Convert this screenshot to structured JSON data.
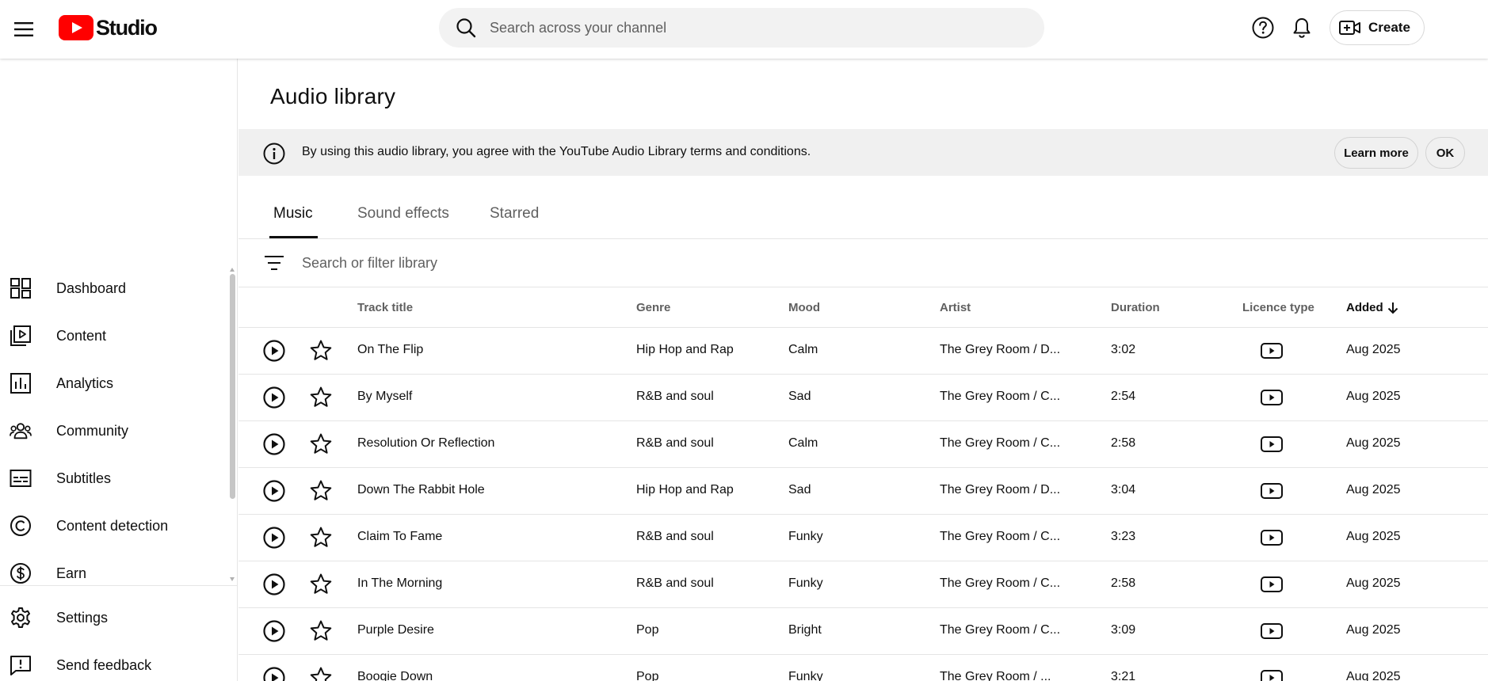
{
  "header": {
    "logo_text": "Studio",
    "search_placeholder": "Search across your channel",
    "create_label": "Create",
    "brand_color": "#ff0000"
  },
  "sidebar": {
    "items": [
      {
        "label": "Dashboard",
        "icon": "dashboard-icon"
      },
      {
        "label": "Content",
        "icon": "content-icon"
      },
      {
        "label": "Analytics",
        "icon": "analytics-icon"
      },
      {
        "label": "Community",
        "icon": "community-icon"
      },
      {
        "label": "Subtitles",
        "icon": "subtitles-icon"
      },
      {
        "label": "Content detection",
        "icon": "content-detection-icon"
      },
      {
        "label": "Earn",
        "icon": "earn-icon"
      }
    ],
    "bottom_items": [
      {
        "label": "Settings",
        "icon": "gear-icon"
      },
      {
        "label": "Send feedback",
        "icon": "feedback-icon"
      }
    ]
  },
  "main": {
    "title": "Audio library",
    "banner": {
      "text": "By using this audio library, you agree with the YouTube Audio Library terms and conditions.",
      "learn_more": "Learn more",
      "ok": "OK"
    },
    "tabs": [
      {
        "label": "Music",
        "active": true
      },
      {
        "label": "Sound effects",
        "active": false
      },
      {
        "label": "Starred",
        "active": false
      }
    ],
    "filter_placeholder": "Search or filter library",
    "columns": {
      "track": "Track title",
      "genre": "Genre",
      "mood": "Mood",
      "artist": "Artist",
      "duration": "Duration",
      "licence": "Licence type",
      "added": "Added"
    },
    "tracks": [
      {
        "title": "On The Flip",
        "genre": "Hip Hop and Rap",
        "mood": "Calm",
        "artist": "The Grey Room / D...",
        "duration": "3:02",
        "added": "Aug 2025"
      },
      {
        "title": "By Myself",
        "genre": "R&B and soul",
        "mood": "Sad",
        "artist": "The Grey Room / C...",
        "duration": "2:54",
        "added": "Aug 2025"
      },
      {
        "title": "Resolution Or Reflection",
        "genre": "R&B and soul",
        "mood": "Calm",
        "artist": "The Grey Room / C...",
        "duration": "2:58",
        "added": "Aug 2025"
      },
      {
        "title": "Down The Rabbit Hole",
        "genre": "Hip Hop and Rap",
        "mood": "Sad",
        "artist": "The Grey Room / D...",
        "duration": "3:04",
        "added": "Aug 2025"
      },
      {
        "title": "Claim To Fame",
        "genre": "R&B and soul",
        "mood": "Funky",
        "artist": "The Grey Room / C...",
        "duration": "3:23",
        "added": "Aug 2025"
      },
      {
        "title": "In The Morning",
        "genre": "R&B and soul",
        "mood": "Funky",
        "artist": "The Grey Room / C...",
        "duration": "2:58",
        "added": "Aug 2025"
      },
      {
        "title": "Purple Desire",
        "genre": "Pop",
        "mood": "Bright",
        "artist": "The Grey Room / C...",
        "duration": "3:09",
        "added": "Aug 2025"
      },
      {
        "title": "Boogie Down",
        "genre": "Pop",
        "mood": "Funky",
        "artist": "The Grey Room / ...",
        "duration": "3:21",
        "added": "Aug 2025"
      }
    ]
  }
}
